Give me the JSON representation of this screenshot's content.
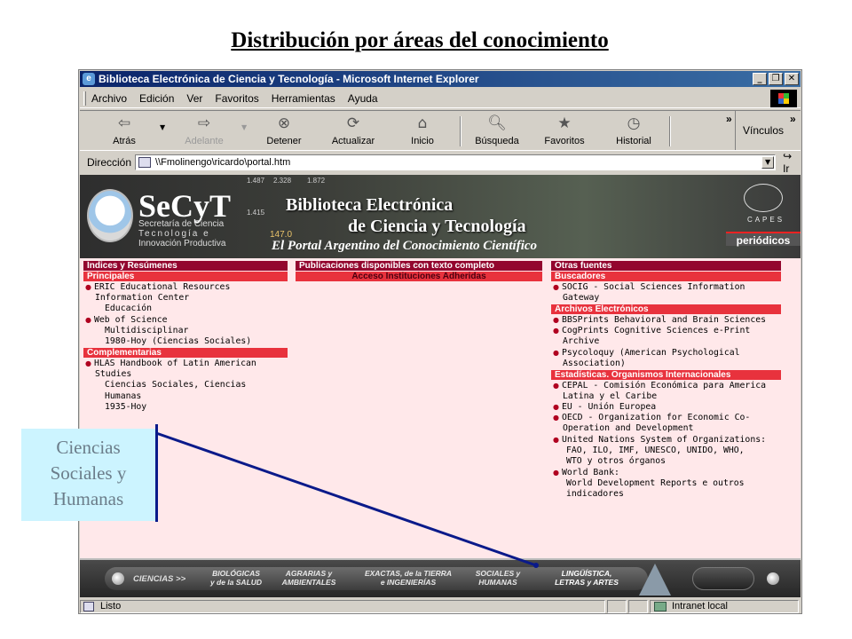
{
  "slide_title": "Distribución por áreas del conocimiento",
  "browser": {
    "window_title": "Biblioteca Electrónica de Ciencia y Tecnología - Microsoft Internet Explorer",
    "window_buttons": [
      "_",
      "❐",
      "✕"
    ],
    "menu": [
      "Archivo",
      "Edición",
      "Ver",
      "Favoritos",
      "Herramientas",
      "Ayuda"
    ],
    "toolbar": {
      "back": "Atrás",
      "forward": "Adelante",
      "stop": "Detener",
      "refresh": "Actualizar",
      "home": "Inicio",
      "search": "Búsqueda",
      "favorites": "Favoritos",
      "history": "Historial",
      "links": "Vínculos",
      "more": "»"
    },
    "address": {
      "label": "Dirección",
      "value": "\\\\Fmolinengo\\ricardo\\portal.htm",
      "go": "Ir"
    },
    "status": {
      "left": "Listo",
      "right": "Intranet local"
    }
  },
  "site": {
    "banner": {
      "logo_text": "SeCyT",
      "logo_sub": [
        "Secretaría de Ciencia",
        "Tecnología e",
        "Innovación Productiva"
      ],
      "title_line1": "Biblioteca Electrónica",
      "title_line2": "de Ciencia y Tecnología",
      "tagline": "El Portal Argentino del Conocimiento Científico",
      "capes": "CAPES",
      "periodicos": "periódicos",
      "deco_numbers": [
        "1.487",
        "2.328",
        "1.872",
        "1.415",
        "147.0"
      ]
    },
    "col1": {
      "header": "Índices y Resúmenes",
      "principales": "Principales",
      "eric": [
        "ERIC Educational Resources",
        "Information Center",
        "Educación"
      ],
      "wos": [
        "Web of Science",
        "Multidisciplinar",
        "1980-Hoy (Ciencias Sociales)"
      ],
      "complementarias": "Complementarias",
      "hlas": [
        "HLAS Handbook of Latin American",
        "Studies",
        "Ciencias Sociales, Ciencias",
        "Humanas",
        "1935-Hoy"
      ]
    },
    "col2": {
      "header": "Publicaciones disponibles con texto completo",
      "sub": "Acceso Instituciones Adheridas"
    },
    "col3": {
      "header": "Otras fuentes",
      "buscadores": "Buscadores",
      "socig": [
        "SOCIG - Social Sciences Information",
        "Gateway"
      ],
      "archivos": "Archivos Electrónicos",
      "bbs": "BBSPrints Behavioral and Brain Sciences",
      "cog": [
        "CogPrints Cognitive Sciences e-Print",
        "Archive"
      ],
      "psy": [
        "Psycoloquy (American Psychological",
        "Association)"
      ],
      "estadisticas": "Estadísticas. Organismos Internacionales",
      "cepal": [
        "CEPAL - Comisión Económica para America",
        "Latina y el Caribe"
      ],
      "eu": "EU - Unión Europea",
      "oecd": [
        "OECD - Organization for Economic Co-",
        "Operation and Development"
      ],
      "un": [
        "United Nations System of Organizations:",
        "FAO, ILO, IMF, UNESCO, UNIDO, WHO,",
        "WTO y otros órganos"
      ],
      "wb": [
        "World Bank:",
        "World Development Reports e outros",
        "indicadores"
      ]
    },
    "bottom_nav": {
      "ciencias": "CIENCIAS >>",
      "items": [
        [
          "BIOLÓGICAS",
          "y de la SALUD"
        ],
        [
          "AGRARIAS y",
          "AMBIENTALES"
        ],
        [
          "EXACTAS, de la TIERRA",
          "e INGENIERÍAS"
        ],
        [
          "SOCIALES y",
          "HUMANAS"
        ],
        [
          "LINGÜÍSTICA,",
          "LETRAS y ARTES"
        ]
      ]
    }
  },
  "callout": {
    "lines": [
      "Ciencias",
      "Sociales y",
      "Humanas"
    ]
  }
}
